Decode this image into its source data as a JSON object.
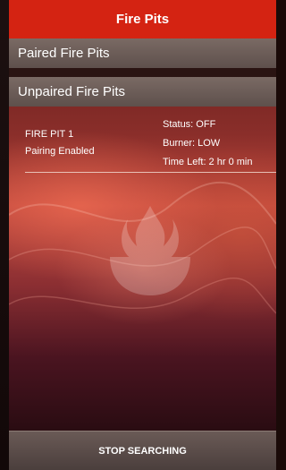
{
  "header": {
    "title": "Fire Pits"
  },
  "sections": {
    "paired": {
      "label": "Paired Fire Pits"
    },
    "unpaired": {
      "label": "Unpaired Fire Pits"
    }
  },
  "device": {
    "name": "FIRE PIT 1",
    "pairing": "Pairing Enabled",
    "status": "Status: OFF",
    "burner": "Burner: LOW",
    "time_left": "Time Left: 2 hr 0 min"
  },
  "footer": {
    "button_label": "STOP SEARCHING"
  },
  "colors": {
    "header_bg": "#d42312",
    "section_bg": "#6c5c57",
    "footer_bg": "#5a4c49"
  },
  "background_icon": "flame-bowl-icon"
}
